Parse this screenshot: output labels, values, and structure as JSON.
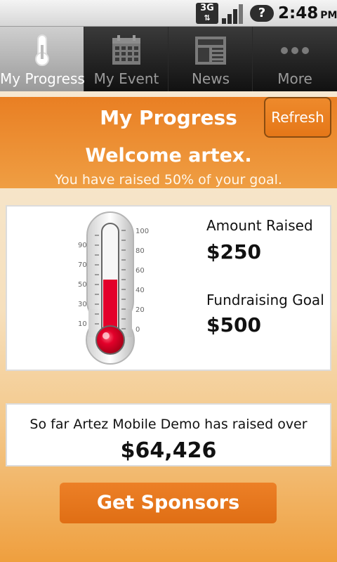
{
  "status_bar": {
    "network": "3G",
    "notification": "?",
    "time": "2:48",
    "ampm": "PM"
  },
  "tabs": [
    {
      "label": "My Progress",
      "icon": "thermometer-icon",
      "active": true
    },
    {
      "label": "My Event",
      "icon": "calendar-icon",
      "active": false
    },
    {
      "label": "News",
      "icon": "newspaper-icon",
      "active": false
    },
    {
      "label": "More",
      "icon": "more-dots-icon",
      "active": false
    }
  ],
  "header": {
    "title": "My Progress",
    "refresh_label": "Refresh",
    "welcome": "Welcome artex.",
    "progress_message": "You have raised 50% of your goal."
  },
  "progress": {
    "percent": 50,
    "scale_left": [
      "90",
      "70",
      "50",
      "30",
      "10"
    ],
    "scale_right": [
      "100",
      "80",
      "60",
      "40",
      "20",
      "0"
    ],
    "amount_raised_label": "Amount Raised",
    "amount_raised_value": "$250",
    "goal_label": "Fundraising Goal",
    "goal_value": "$500"
  },
  "total": {
    "text": "So far Artez Mobile Demo has raised over",
    "amount": "$64,426"
  },
  "actions": {
    "get_sponsors_label": "Get Sponsors"
  },
  "colors": {
    "accent": "#e97f23",
    "mercury": "#e3002a"
  }
}
